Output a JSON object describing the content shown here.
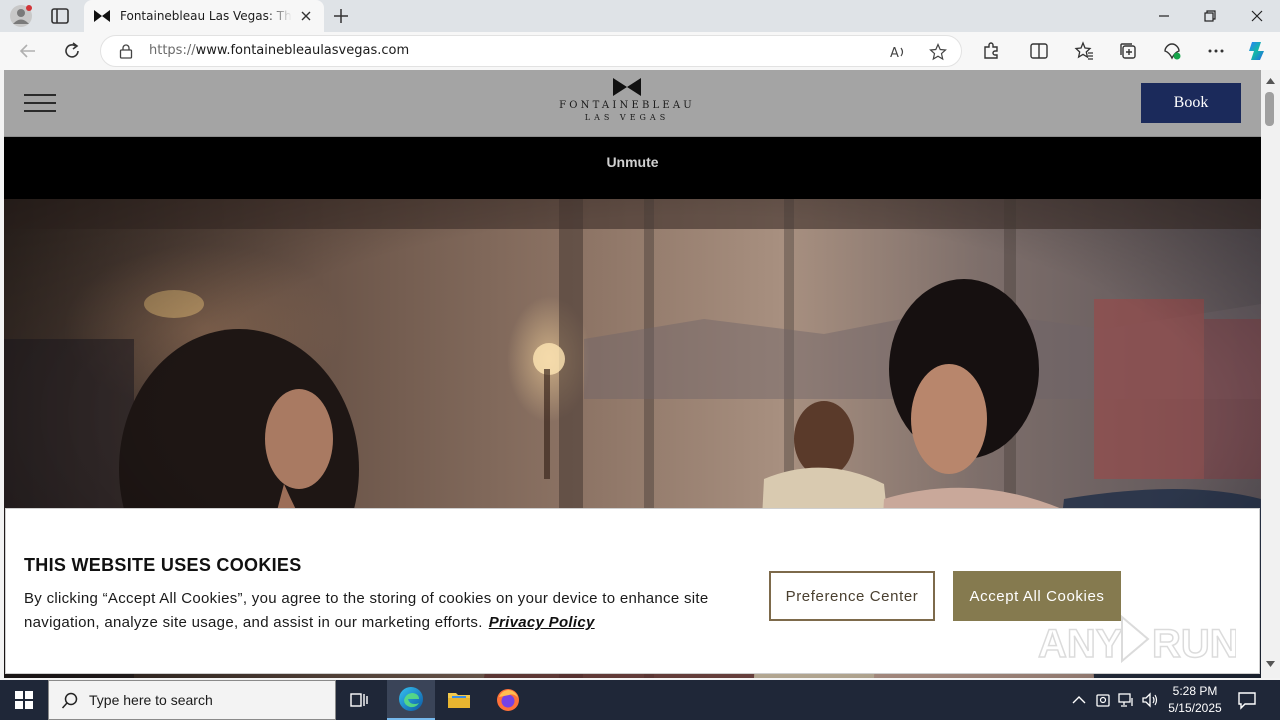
{
  "browser": {
    "tab_title": "Fontainebleau Las Vegas: The Best Luxury Hotel",
    "url_prefix": "https://",
    "url_host": "www.fontainebleaulasvegas.com"
  },
  "site": {
    "logo_name": "FONTAINEBLEAU",
    "logo_sub": "LAS VEGAS",
    "book_label": "Book",
    "unmute_label": "Unmute"
  },
  "cookie": {
    "title": "THIS WEBSITE USES COOKIES",
    "text": "By clicking “Accept All Cookies”, you agree to the storing of cookies on your device to enhance site navigation, analyze site usage, and assist in our marketing efforts.",
    "policy_link": "Privacy Policy",
    "preference_label": "Preference Center",
    "accept_label": "Accept All Cookies"
  },
  "taskbar": {
    "search_placeholder": "Type here to search",
    "time": "5:28 PM",
    "date": "5/15/2025"
  },
  "colors": {
    "brand_navy": "#1b2a5b",
    "accent_gold": "#857a4f",
    "header_gray": "#a4a4a4"
  }
}
